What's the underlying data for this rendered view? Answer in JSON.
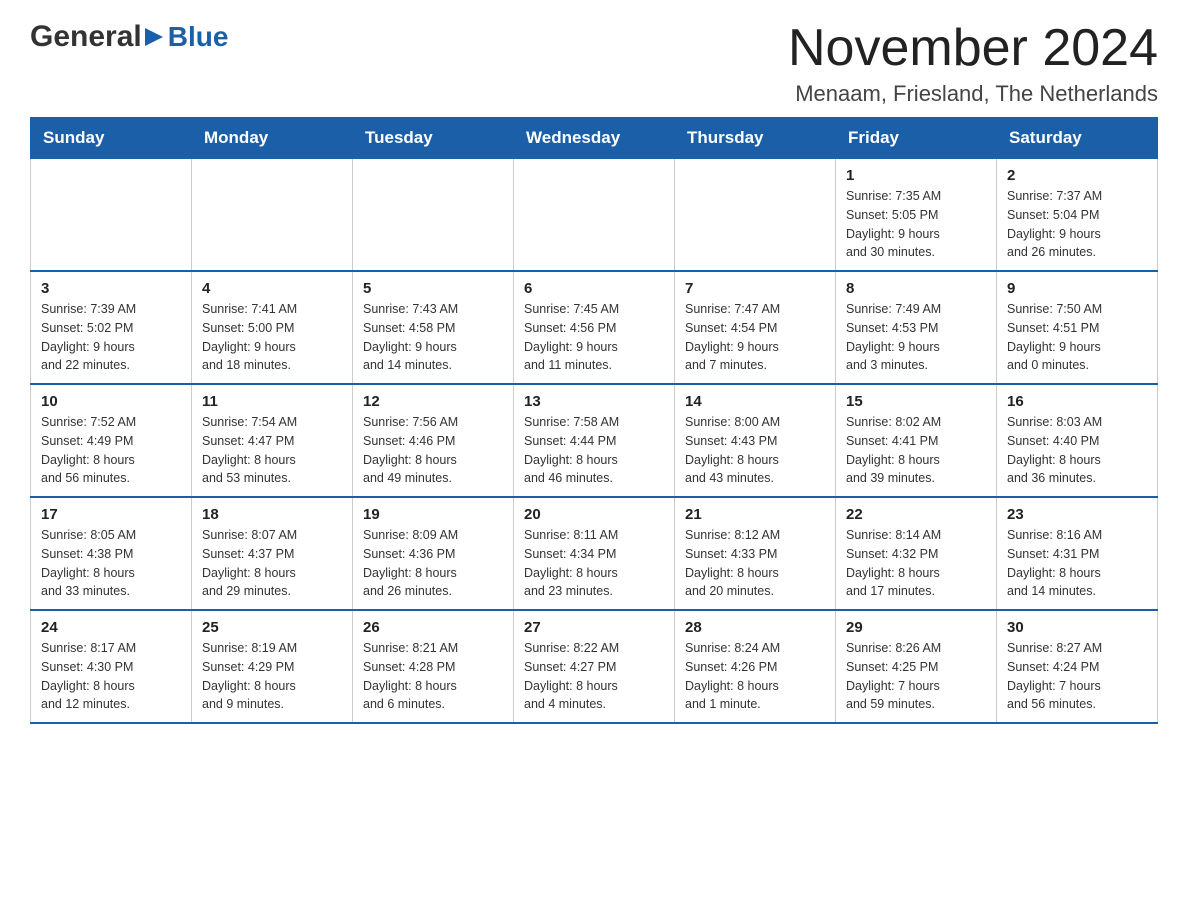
{
  "header": {
    "logo_general": "General",
    "logo_blue": "Blue",
    "month_title": "November 2024",
    "location": "Menaam, Friesland, The Netherlands"
  },
  "days_of_week": [
    "Sunday",
    "Monday",
    "Tuesday",
    "Wednesday",
    "Thursday",
    "Friday",
    "Saturday"
  ],
  "weeks": [
    [
      {
        "day": "",
        "info": ""
      },
      {
        "day": "",
        "info": ""
      },
      {
        "day": "",
        "info": ""
      },
      {
        "day": "",
        "info": ""
      },
      {
        "day": "",
        "info": ""
      },
      {
        "day": "1",
        "info": "Sunrise: 7:35 AM\nSunset: 5:05 PM\nDaylight: 9 hours\nand 30 minutes."
      },
      {
        "day": "2",
        "info": "Sunrise: 7:37 AM\nSunset: 5:04 PM\nDaylight: 9 hours\nand 26 minutes."
      }
    ],
    [
      {
        "day": "3",
        "info": "Sunrise: 7:39 AM\nSunset: 5:02 PM\nDaylight: 9 hours\nand 22 minutes."
      },
      {
        "day": "4",
        "info": "Sunrise: 7:41 AM\nSunset: 5:00 PM\nDaylight: 9 hours\nand 18 minutes."
      },
      {
        "day": "5",
        "info": "Sunrise: 7:43 AM\nSunset: 4:58 PM\nDaylight: 9 hours\nand 14 minutes."
      },
      {
        "day": "6",
        "info": "Sunrise: 7:45 AM\nSunset: 4:56 PM\nDaylight: 9 hours\nand 11 minutes."
      },
      {
        "day": "7",
        "info": "Sunrise: 7:47 AM\nSunset: 4:54 PM\nDaylight: 9 hours\nand 7 minutes."
      },
      {
        "day": "8",
        "info": "Sunrise: 7:49 AM\nSunset: 4:53 PM\nDaylight: 9 hours\nand 3 minutes."
      },
      {
        "day": "9",
        "info": "Sunrise: 7:50 AM\nSunset: 4:51 PM\nDaylight: 9 hours\nand 0 minutes."
      }
    ],
    [
      {
        "day": "10",
        "info": "Sunrise: 7:52 AM\nSunset: 4:49 PM\nDaylight: 8 hours\nand 56 minutes."
      },
      {
        "day": "11",
        "info": "Sunrise: 7:54 AM\nSunset: 4:47 PM\nDaylight: 8 hours\nand 53 minutes."
      },
      {
        "day": "12",
        "info": "Sunrise: 7:56 AM\nSunset: 4:46 PM\nDaylight: 8 hours\nand 49 minutes."
      },
      {
        "day": "13",
        "info": "Sunrise: 7:58 AM\nSunset: 4:44 PM\nDaylight: 8 hours\nand 46 minutes."
      },
      {
        "day": "14",
        "info": "Sunrise: 8:00 AM\nSunset: 4:43 PM\nDaylight: 8 hours\nand 43 minutes."
      },
      {
        "day": "15",
        "info": "Sunrise: 8:02 AM\nSunset: 4:41 PM\nDaylight: 8 hours\nand 39 minutes."
      },
      {
        "day": "16",
        "info": "Sunrise: 8:03 AM\nSunset: 4:40 PM\nDaylight: 8 hours\nand 36 minutes."
      }
    ],
    [
      {
        "day": "17",
        "info": "Sunrise: 8:05 AM\nSunset: 4:38 PM\nDaylight: 8 hours\nand 33 minutes."
      },
      {
        "day": "18",
        "info": "Sunrise: 8:07 AM\nSunset: 4:37 PM\nDaylight: 8 hours\nand 29 minutes."
      },
      {
        "day": "19",
        "info": "Sunrise: 8:09 AM\nSunset: 4:36 PM\nDaylight: 8 hours\nand 26 minutes."
      },
      {
        "day": "20",
        "info": "Sunrise: 8:11 AM\nSunset: 4:34 PM\nDaylight: 8 hours\nand 23 minutes."
      },
      {
        "day": "21",
        "info": "Sunrise: 8:12 AM\nSunset: 4:33 PM\nDaylight: 8 hours\nand 20 minutes."
      },
      {
        "day": "22",
        "info": "Sunrise: 8:14 AM\nSunset: 4:32 PM\nDaylight: 8 hours\nand 17 minutes."
      },
      {
        "day": "23",
        "info": "Sunrise: 8:16 AM\nSunset: 4:31 PM\nDaylight: 8 hours\nand 14 minutes."
      }
    ],
    [
      {
        "day": "24",
        "info": "Sunrise: 8:17 AM\nSunset: 4:30 PM\nDaylight: 8 hours\nand 12 minutes."
      },
      {
        "day": "25",
        "info": "Sunrise: 8:19 AM\nSunset: 4:29 PM\nDaylight: 8 hours\nand 9 minutes."
      },
      {
        "day": "26",
        "info": "Sunrise: 8:21 AM\nSunset: 4:28 PM\nDaylight: 8 hours\nand 6 minutes."
      },
      {
        "day": "27",
        "info": "Sunrise: 8:22 AM\nSunset: 4:27 PM\nDaylight: 8 hours\nand 4 minutes."
      },
      {
        "day": "28",
        "info": "Sunrise: 8:24 AM\nSunset: 4:26 PM\nDaylight: 8 hours\nand 1 minute."
      },
      {
        "day": "29",
        "info": "Sunrise: 8:26 AM\nSunset: 4:25 PM\nDaylight: 7 hours\nand 59 minutes."
      },
      {
        "day": "30",
        "info": "Sunrise: 8:27 AM\nSunset: 4:24 PM\nDaylight: 7 hours\nand 56 minutes."
      }
    ]
  ]
}
